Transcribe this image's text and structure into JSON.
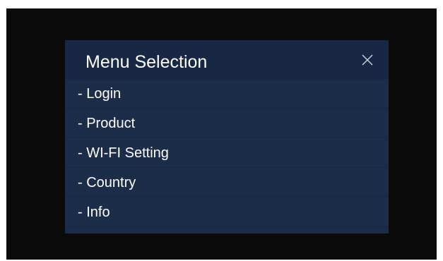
{
  "dialog": {
    "title": "Menu Selection",
    "close_icon": "close-icon"
  },
  "menu": {
    "items": [
      {
        "label": "- Login"
      },
      {
        "label": "- Product"
      },
      {
        "label": "- WI-FI Setting"
      },
      {
        "label": "- Country"
      },
      {
        "label": "- Info"
      }
    ]
  },
  "colors": {
    "screen_background": "#0b0b0b",
    "dialog_background": "#1c2d49",
    "header_background": "#182744",
    "text": "#ffffff"
  }
}
